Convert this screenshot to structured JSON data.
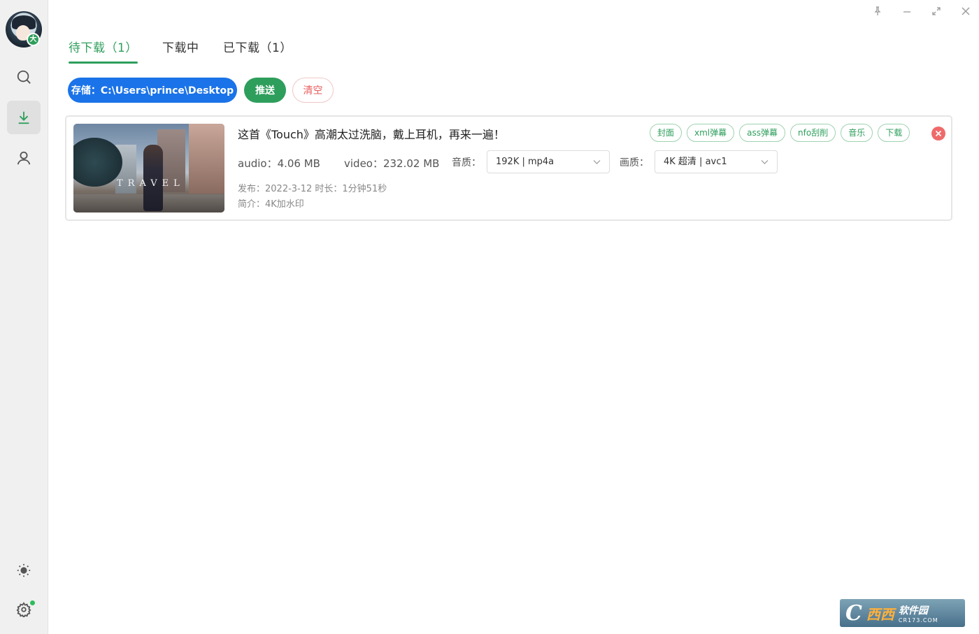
{
  "window": {
    "controls": [
      "pin-icon",
      "minimize-icon",
      "restore-icon",
      "close-icon"
    ]
  },
  "sidebar": {
    "avatar_badge": "大",
    "items": [
      {
        "name": "search",
        "icon": "search-icon"
      },
      {
        "name": "download",
        "icon": "download-icon",
        "active": true
      },
      {
        "name": "user",
        "icon": "user-icon"
      }
    ],
    "bottom": [
      {
        "name": "theme",
        "icon": "sun-icon"
      },
      {
        "name": "settings",
        "icon": "gear-icon",
        "notify": true
      }
    ]
  },
  "tabs": [
    {
      "label": "待下载（1）",
      "active": true
    },
    {
      "label": "下载中",
      "active": false
    },
    {
      "label": "已下载（1）",
      "active": false
    }
  ],
  "actions": {
    "storage_label": "存储：C:\\Users\\prince\\Desktop",
    "push_label": "推送",
    "clear_label": "清空"
  },
  "item": {
    "thumbnail_text": "TRAVEL",
    "title": "这首《Touch》高潮太过洗脑，戴上耳机，再来一遍！",
    "tags": [
      "封面",
      "xml弹幕",
      "ass弹幕",
      "nfo刮削",
      "音乐",
      "下载"
    ],
    "audio_size": "audio：4.06 MB",
    "video_size": "video：232.02 MB",
    "audio_quality_label": "音质：",
    "audio_quality_value": "192K | mp4a",
    "video_quality_label": "画质：",
    "video_quality_value": "4K 超清 | avc1",
    "published": "发布：2022-3-12 时长：1分钟51秒",
    "intro": "简介：4K加水印"
  },
  "watermark": {
    "logo": "C",
    "brand": "西西",
    "name": "软件园",
    "domain": "CR173.COM"
  },
  "colors": {
    "accent": "#2e9e5c",
    "primary": "#1a73e8",
    "danger": "#e85c5c"
  }
}
